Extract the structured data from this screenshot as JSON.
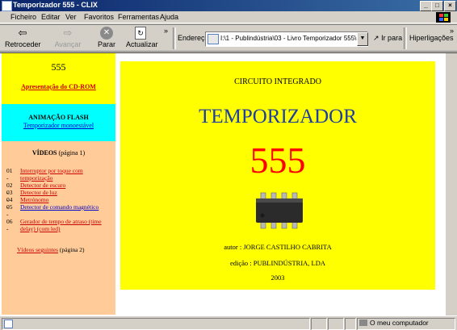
{
  "window": {
    "title": "Temporizador 555 - CLIX",
    "controls": [
      "_",
      "□",
      "×"
    ]
  },
  "menu": [
    "Ficheiro",
    "Editar",
    "Ver",
    "Favoritos",
    "Ferramentas",
    "Ajuda"
  ],
  "toolbar": {
    "back": "Retroceder",
    "forward": "Avançar",
    "stop": "Parar",
    "refresh": "Actualizar",
    "address_label": "Endereço",
    "address_value": "I:\\1 - Publindústria\\03 - Livro Temporizador 555\\5 -",
    "go": "Ir para",
    "links": "Hiperligações",
    "chevron": "»"
  },
  "sidebar": {
    "top_number": "555",
    "presentation_link": "Apresentação do CD-ROM",
    "flash_title": "ANIMAÇÃO FLASH",
    "flash_link": "Temporizador monoestável",
    "videos_title": "VÍDEOS",
    "videos_page": "(página 1)",
    "videos": [
      {
        "num": "01 -",
        "label": "Interruptor por toque com temporização"
      },
      {
        "num": "02 -",
        "label": "Detector de escuro"
      },
      {
        "num": "03 -",
        "label": "Detector de luz"
      },
      {
        "num": "04 -",
        "label": "Metrónomo"
      },
      {
        "num": "05 -",
        "label": "Detector de comando magnético"
      },
      {
        "num": "06 -",
        "label": "Gerador de tempo de atraso (time delay) (com led)"
      }
    ],
    "next_videos_link": "Vídeos seguintes",
    "next_videos_page": "(página 2)"
  },
  "main": {
    "subtitle": "CIRCUITO INTEGRADO",
    "title": "TEMPORIZADOR",
    "number": "555",
    "author": "autor : JORGE CASTILHO CABRITA",
    "publisher": "edição : PUBLINDÚSTRIA, LDA",
    "year": "2003"
  },
  "status": {
    "zone": "O meu computador"
  },
  "colors": {
    "title_blue": "#1f3fa0",
    "number_red": "#ff0000",
    "panel_yellow": "#ffff00",
    "sidebar_cyan": "#00ffff",
    "sidebar_peach": "#ffcc99"
  }
}
